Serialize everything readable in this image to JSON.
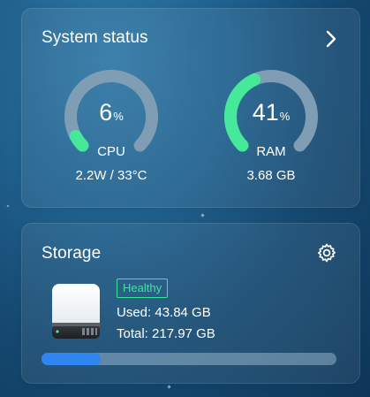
{
  "system": {
    "title": "System status",
    "cpu": {
      "percent": 6,
      "value": "6",
      "unit": "%",
      "label": "CPU",
      "detail": "2.2W / 33°C"
    },
    "ram": {
      "percent": 41,
      "value": "41",
      "unit": "%",
      "label": "RAM",
      "detail": "3.68 GB"
    }
  },
  "storage": {
    "title": "Storage",
    "status_badge": "Healthy",
    "used_label": "Used: 43.84 GB",
    "total_label": "Total: 217.97 GB",
    "used_fraction": 0.2011
  },
  "icons": {
    "open_details": "chevron-right-icon",
    "settings": "gear-icon",
    "drive": "hard-drive-icon"
  },
  "colors": {
    "gauge_active": "#46e89a",
    "gauge_track": "#7f9db3",
    "healthy": "#38e89a",
    "progress_fill": "#2f86f0"
  }
}
